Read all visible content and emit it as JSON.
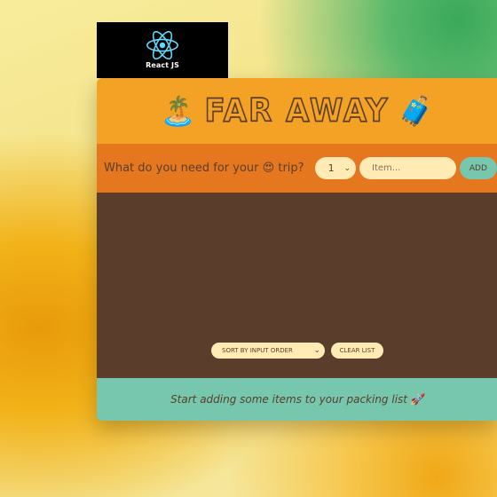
{
  "badge": {
    "label": "React JS",
    "color": "#61dafb"
  },
  "header": {
    "left_emoji": "🏝️",
    "title": "FAR AWAY",
    "right_emoji": "🧳"
  },
  "form": {
    "question_before": "What do you need for your",
    "question_emoji": "😍",
    "question_after": "trip?",
    "quantity_value": "1",
    "item_placeholder": "Item...",
    "add_label": "ADD"
  },
  "list": {
    "items": [],
    "sort_value": "SORT BY INPUT ORDER",
    "clear_label": "CLEAR LIST"
  },
  "stats": {
    "text": "Start adding some items to your packing list",
    "emoji": "🚀"
  },
  "colors": {
    "header_bg": "#f4a226",
    "form_bg": "#e5771f",
    "list_bg": "#5a3e2b",
    "stats_bg": "#76c7ad",
    "input_bg": "#ffebb3",
    "text_dark": "#5a3e2b"
  }
}
